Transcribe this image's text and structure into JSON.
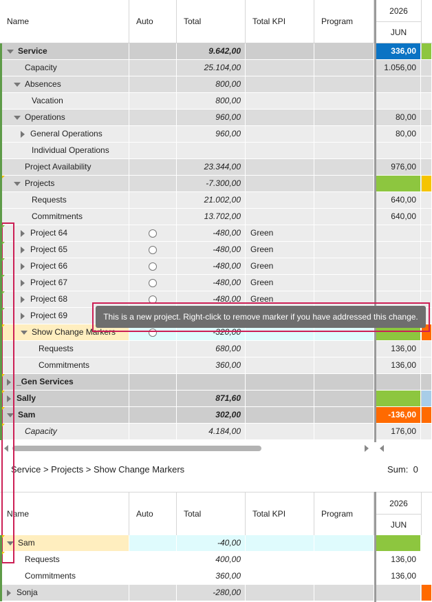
{
  "columns": {
    "name": "Name",
    "auto": "Auto",
    "total": "Total",
    "kpi": "Total KPI",
    "program": "Program",
    "year": "2026",
    "month": "JUN"
  },
  "top_rows": [
    {
      "id": "service",
      "name": "Service",
      "total": "9.642,00",
      "jun": "336,00",
      "bold": true,
      "expand": "down",
      "indent": 0,
      "bg": "dark",
      "jun_color": "#0a73c4",
      "jul_color": "#8dc63f",
      "jun_text_color": "#ffffff"
    },
    {
      "id": "capacity",
      "name": "Capacity",
      "total": "25.104,00",
      "jun": "1.056,00",
      "indent": 1,
      "bg": "mid"
    },
    {
      "id": "absences",
      "name": "Absences",
      "total": "800,00",
      "expand": "down",
      "indent": 1,
      "bg": "mid"
    },
    {
      "id": "vacation",
      "name": "Vacation",
      "total": "800,00",
      "indent": 2,
      "bg": "light"
    },
    {
      "id": "operations",
      "name": "Operations",
      "total": "960,00",
      "jun": "80,00",
      "expand": "down",
      "indent": 1,
      "bg": "mid"
    },
    {
      "id": "general-operations",
      "name": "General Operations",
      "total": "960,00",
      "jun": "80,00",
      "expand": "right",
      "indent": 2,
      "bg": "light"
    },
    {
      "id": "individual-operations",
      "name": "Individual Operations",
      "indent": 2,
      "bg": "light"
    },
    {
      "id": "project-availability",
      "name": "Project Availability",
      "total": "23.344,00",
      "jun": "976,00",
      "indent": 1,
      "bg": "mid"
    },
    {
      "id": "projects",
      "name": "Projects",
      "total": "-7.300,00",
      "expand": "down",
      "indent": 1,
      "bg": "mid",
      "jun_color": "#8dc63f",
      "jul_color": "#f5c400"
    },
    {
      "id": "requests",
      "name": "Requests",
      "total": "21.002,00",
      "jun": "640,00",
      "indent": 2,
      "bg": "light"
    },
    {
      "id": "commitments",
      "name": "Commitments",
      "total": "13.702,00",
      "jun": "640,00",
      "indent": 2,
      "bg": "light"
    },
    {
      "id": "project-64",
      "name": "Project 64",
      "total": "-480,00",
      "kpi": "Green",
      "expand": "right",
      "indent": 2,
      "bg": "light",
      "radio": true
    },
    {
      "id": "project-65",
      "name": "Project 65",
      "total": "-480,00",
      "kpi": "Green",
      "expand": "right",
      "indent": 2,
      "bg": "light",
      "radio": true
    },
    {
      "id": "project-66",
      "name": "Project 66",
      "total": "-480,00",
      "kpi": "Green",
      "expand": "right",
      "indent": 2,
      "bg": "light",
      "radio": true
    },
    {
      "id": "project-67",
      "name": "Project 67",
      "total": "-480,00",
      "kpi": "Green",
      "expand": "right",
      "indent": 2,
      "bg": "light",
      "radio": true
    },
    {
      "id": "project-68",
      "name": "Project 68",
      "total": "-480,00",
      "kpi": "Green",
      "expand": "right",
      "indent": 2,
      "bg": "light",
      "radio": true
    },
    {
      "id": "project-69",
      "name": "Project 69",
      "expand": "right",
      "indent": 2,
      "bg": "light"
    },
    {
      "id": "show-change-markers",
      "name": "Show Change Markers",
      "total": "-320,00",
      "expand": "down",
      "indent": 2,
      "bg": "highlight",
      "radio": true,
      "jun_color": "#8dc63f",
      "jul_color": "#ff6a00"
    },
    {
      "id": "scm-requests",
      "name": "Requests",
      "total": "680,00",
      "jun": "136,00",
      "indent": 3,
      "bg": "light"
    },
    {
      "id": "scm-commitments",
      "name": "Commitments",
      "total": "360,00",
      "jun": "136,00",
      "indent": 3,
      "bg": "light"
    },
    {
      "id": "gen-services",
      "name": "_Gen Services",
      "expand": "right",
      "indent": 0,
      "bg": "dark",
      "bold": true
    },
    {
      "id": "sally",
      "name": "Sally",
      "total": "871,60",
      "expand": "right",
      "indent": 0,
      "bg": "dark",
      "bold": true,
      "jun_color": "#8dc63f",
      "jul_color": "#a8cde8"
    },
    {
      "id": "sam",
      "name": "Sam",
      "total": "302,00",
      "jun": "-136,00",
      "expand": "down",
      "indent": 0,
      "bg": "dark",
      "bold": true,
      "jun_color": "#ff6a00",
      "jul_color": "#ff6a00",
      "jun_text_color": "#ffffff"
    },
    {
      "id": "sam-capacity",
      "name": "Capacity",
      "total": "4.184,00",
      "jun": "176,00",
      "indent": 1,
      "bg": "light",
      "italic": true
    }
  ],
  "tooltip": "This is a new project. Right-click to remove marker if you have addressed this change.",
  "breadcrumb": "Service > Projects > Show Change Markers",
  "sum_label": "Sum:",
  "sum_value": "0",
  "bottom_rows": [
    {
      "id": "b-sam",
      "name": "Sam",
      "total": "-40,00",
      "expand": "down",
      "indent": 0,
      "bg": "highlight",
      "jun_color": "#8dc63f"
    },
    {
      "id": "b-requests",
      "name": "Requests",
      "total": "400,00",
      "jun": "136,00",
      "indent": 1,
      "bg": "white"
    },
    {
      "id": "b-commitments",
      "name": "Commitments",
      "total": "360,00",
      "jun": "136,00",
      "indent": 1,
      "bg": "white"
    },
    {
      "id": "b-sonja",
      "name": "Sonja",
      "total": "-280,00",
      "expand": "right",
      "indent": 0,
      "bg": "mid",
      "jul_color": "#ff6a00"
    }
  ],
  "colors": {
    "accent_green": "#5e9b48",
    "marker_yellow": "#f0c000",
    "highlight_row": "#ffeebf",
    "highlight_cyan": "#dffbfd",
    "red_box": "#cc1f55"
  }
}
